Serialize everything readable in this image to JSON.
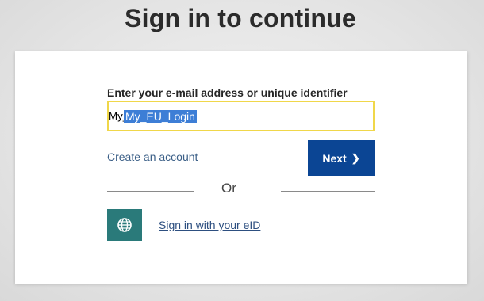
{
  "page": {
    "title": "Sign in to continue"
  },
  "login_form": {
    "identifier_label": "Enter your e-mail address or unique identifier",
    "identifier_value": "My_EU_Login",
    "create_account_link": "Create an account",
    "next_button_label": "Next",
    "next_button_icon": "chevron-right-icon",
    "next_button_chevron": "❯",
    "or_separator": "Or",
    "eid_icon": "globe-icon",
    "eid_link": "Sign in with your eID"
  },
  "colors": {
    "primary_button": "#0b4594",
    "input_focus_border": "#f0d74a",
    "eid_icon_bg": "#2a7a7a",
    "link": "#3b5f87"
  }
}
